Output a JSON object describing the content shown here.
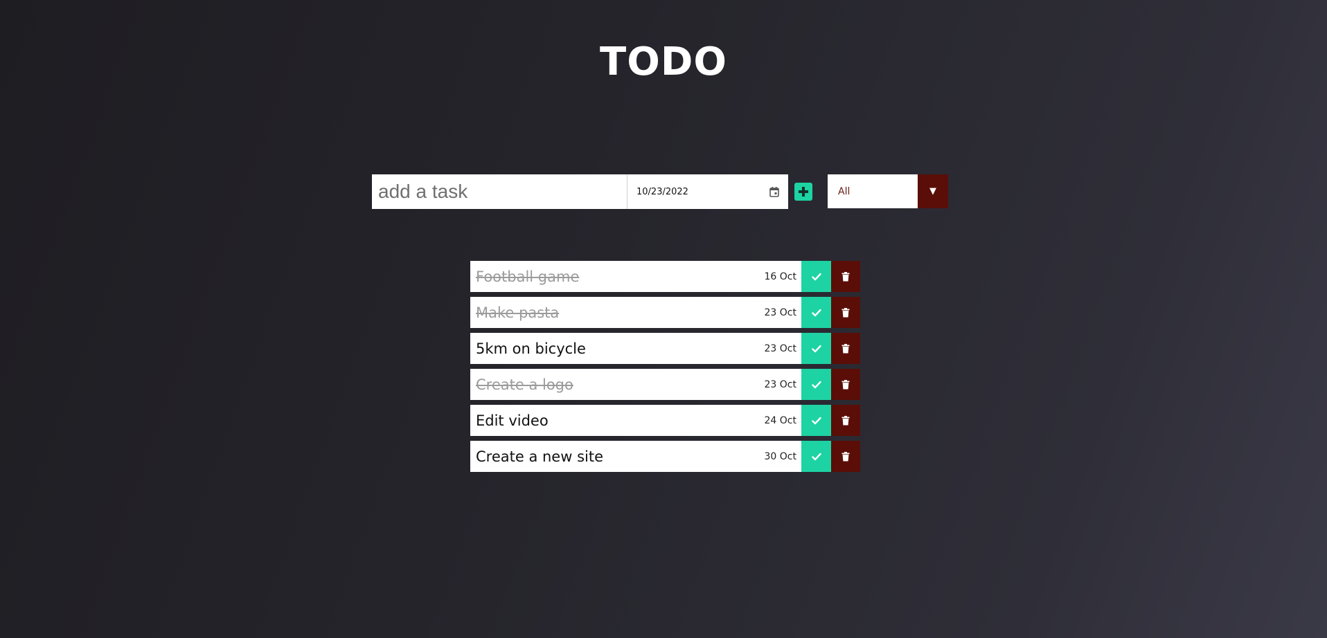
{
  "header": {
    "title": "TODO"
  },
  "form": {
    "task_placeholder": "add a task",
    "task_value": "",
    "date_value": "10/23/2022",
    "add_icon": "plus-icon",
    "calendar_icon": "calendar-icon"
  },
  "filter": {
    "selected": "All",
    "arrow_icon": "caret-down-icon",
    "arrow_glyph": "▼"
  },
  "todos": [
    {
      "text": "Football game",
      "date": "16 Oct",
      "completed": true
    },
    {
      "text": "Make pasta",
      "date": "23 Oct",
      "completed": true
    },
    {
      "text": "5km on bicycle",
      "date": "23 Oct",
      "completed": false
    },
    {
      "text": "Create a logo",
      "date": "23 Oct",
      "completed": true
    },
    {
      "text": "Edit video",
      "date": "24 Oct",
      "completed": false
    },
    {
      "text": "Create a new site",
      "date": "30 Oct",
      "completed": false
    }
  ],
  "colors": {
    "accent_green": "#1dd3a3",
    "accent_dark_red": "#5a0e07",
    "filter_text": "#6b1a10"
  }
}
